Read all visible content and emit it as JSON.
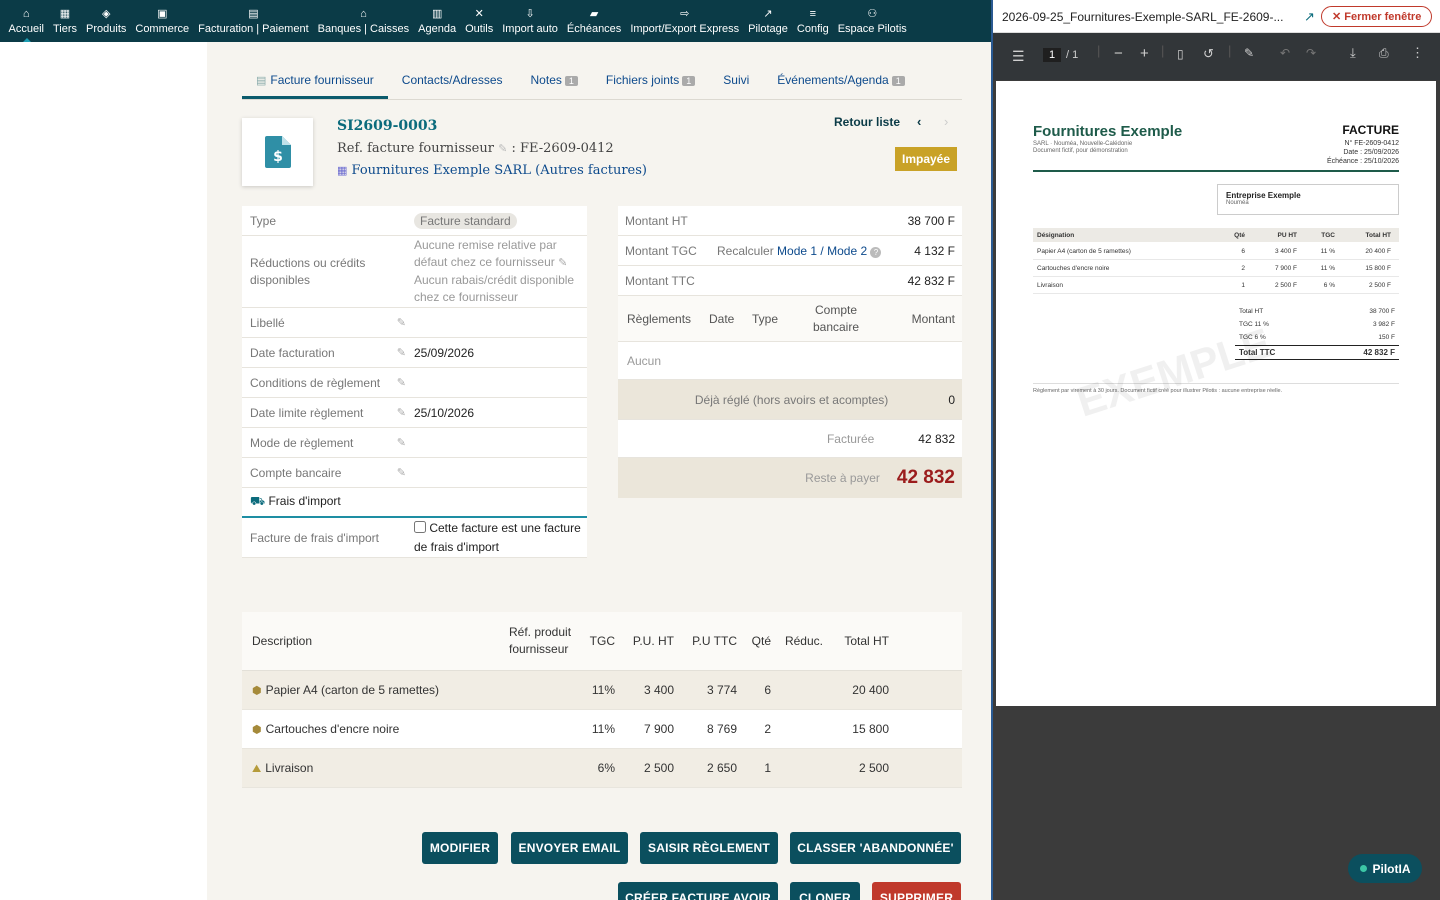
{
  "nav": [
    {
      "icon": "home-icon",
      "glyph": "⌂",
      "label": "Accueil"
    },
    {
      "icon": "building-icon",
      "glyph": "▦",
      "label": "Tiers"
    },
    {
      "icon": "cube-icon",
      "glyph": "◈",
      "label": "Produits"
    },
    {
      "icon": "briefcase-icon",
      "glyph": "▣",
      "label": "Commerce"
    },
    {
      "icon": "file-invoice-icon",
      "glyph": "▤",
      "label": "Facturation | Paiement"
    },
    {
      "icon": "bank-icon",
      "glyph": "⌂",
      "label": "Banques | Caisses"
    },
    {
      "icon": "calendar-icon",
      "glyph": "▥",
      "label": "Agenda"
    },
    {
      "icon": "tools-icon",
      "glyph": "✕",
      "label": "Outils"
    },
    {
      "icon": "file-import-icon",
      "glyph": "⇩",
      "label": "Import auto"
    },
    {
      "icon": "truck-icon",
      "glyph": "▰",
      "label": "Échéances"
    },
    {
      "icon": "file-export-icon",
      "glyph": "⇨",
      "label": "Import/Export Express"
    },
    {
      "icon": "chart-line-icon",
      "glyph": "↗",
      "label": "Pilotage"
    },
    {
      "icon": "sliders-icon",
      "glyph": "≡",
      "label": "Config"
    },
    {
      "icon": "users-icon",
      "glyph": "⚇",
      "label": "Espace Pilotis"
    }
  ],
  "tabs": [
    {
      "label": "Facture fournisseur",
      "badge": ""
    },
    {
      "label": "Contacts/Adresses",
      "badge": ""
    },
    {
      "label": "Notes",
      "badge": "1"
    },
    {
      "label": "Fichiers joints",
      "badge": "1"
    },
    {
      "label": "Suivi",
      "badge": ""
    },
    {
      "label": "Événements/Agenda",
      "badge": "1"
    }
  ],
  "header": {
    "ref": "SI2609-0003",
    "supplier_ref_label": "Ref. facture fournisseur",
    "supplier_ref_value": ": FE-2609-0412",
    "supplier_name": "Fournitures Exemple SARL",
    "supplier_other": "(Autres factures)",
    "back_label": "Retour liste",
    "prev_glyph": "‹",
    "next_glyph": "›",
    "status": "Impayée"
  },
  "props": {
    "type_label": "Type",
    "type_value": "Facture standard",
    "reductions_label": "Réductions ou crédits disponibles",
    "reductions_line1": "Aucune remise relative par défaut chez ce fournisseur",
    "reductions_line2": "Aucun rabais/crédit disponible chez ce fournisseur",
    "libelle_label": "Libellé",
    "libelle_value": "",
    "date_label": "Date facturation",
    "date_value": "25/09/2026",
    "conditions_label": "Conditions de règlement",
    "conditions_value": "",
    "limit_label": "Date limite règlement",
    "limit_value": "25/10/2026",
    "mode_label": "Mode de règlement",
    "mode_value": "",
    "bank_label": "Compte bancaire",
    "bank_value": "",
    "import_section": "Frais d'import",
    "import_label": "Facture de frais d'import",
    "import_checkbox": "Cette facture est une facture de frais d'import"
  },
  "amounts": {
    "ht_label": "Montant HT",
    "ht_value": "38 700 F",
    "tgc_label": "Montant TGC",
    "recalc_label": "Recalculer",
    "mode1": "Mode 1",
    "sep": "/",
    "mode2": "Mode 2",
    "tgc_value": "4 132 F",
    "ttc_label": "Montant TTC",
    "ttc_value": "42 832 F",
    "pay_headers": [
      "Règlements",
      "Date",
      "Type",
      "Compte bancaire",
      "Montant"
    ],
    "none": "Aucun",
    "already_label": "Déjà réglé (hors avoirs et acomptes)",
    "already_value": "0",
    "billed_label": "Facturée",
    "billed_value": "42 832",
    "rest_label": "Reste à payer",
    "rest_value": "42 832"
  },
  "lines": {
    "headers": [
      "Description",
      "Réf. produit fournisseur",
      "TGC",
      "P.U. HT",
      "P.U TTC",
      "Qté",
      "Réduc.",
      "Total HT"
    ],
    "rows": [
      {
        "icon": "product-box-icon",
        "desc": "Papier A4 (carton de 5 ramettes)",
        "tgc": "11%",
        "puht": "3 400",
        "puttc": "3 774",
        "qty": "6",
        "total": "20 400"
      },
      {
        "icon": "product-box-icon",
        "desc": "Cartouches d'encre noire",
        "tgc": "11%",
        "puht": "7 900",
        "puttc": "8 769",
        "qty": "2",
        "total": "15 800"
      },
      {
        "icon": "service-icon",
        "desc": "Livraison",
        "tgc": "6%",
        "puht": "2 500",
        "puttc": "2 650",
        "qty": "1",
        "total": "2 500"
      }
    ]
  },
  "buttons": {
    "modify": "MODIFIER",
    "email": "ENVOYER EMAIL",
    "payment": "SAISIR RÈGLEMENT",
    "abandon": "CLASSER 'ABANDONNÉE'",
    "credit": "CRÉER FACTURE AVOIR",
    "clone": "CLONER",
    "delete": "SUPPRIMER"
  },
  "pane": {
    "filename": "2026-09-25_Fournitures-Exemple-SARL_FE-2609-...",
    "open_glyph": "↗",
    "close_label": "✕ Fermer fenêtre",
    "page_current": "1",
    "page_total": "/ 1"
  },
  "pdf": {
    "company": "Fournitures Exemple",
    "company_sub1": "SARL · Nouméa, Nouvelle-Calédonie",
    "company_sub2": "Document fictif, pour démonstration",
    "doc_title": "FACTURE",
    "doc_no": "N° FE-2609-0412",
    "doc_date": "Date : 25/09/2026",
    "doc_due": "Échéance : 25/10/2026",
    "client_name": "Entreprise Exemple",
    "client_city": "Nouméa",
    "headers": [
      "Désignation",
      "Qté",
      "PU HT",
      "TGC",
      "Total HT"
    ],
    "rows": [
      [
        "Papier A4 (carton de 5 ramettes)",
        "6",
        "3 400 F",
        "11 %",
        "20 400 F"
      ],
      [
        "Cartouches d'encre noire",
        "2",
        "7 900 F",
        "11 %",
        "15 800 F"
      ],
      [
        "Livraison",
        "1",
        "2 500 F",
        "6 %",
        "2 500 F"
      ]
    ],
    "totals": [
      [
        "Total HT",
        "38 700 F"
      ],
      [
        "TGC 11 %",
        "3 982 F"
      ],
      [
        "TGC 6 %",
        "150 F"
      ]
    ],
    "total_ttc_label": "Total TTC",
    "total_ttc_value": "42 832 F",
    "footer": "Règlement par virement à 30 jours. Document fictif créé pour illustrer Pilotis : aucune entreprise réelle.",
    "watermark": "EXEMPLE"
  },
  "assistant": {
    "label": "PilotIA"
  },
  "colors": {
    "nav": "#0b3b47",
    "accent": "#0b6b7c",
    "status": "#c9a227",
    "danger": "#c0392b",
    "rest": "#9b1c1c"
  }
}
